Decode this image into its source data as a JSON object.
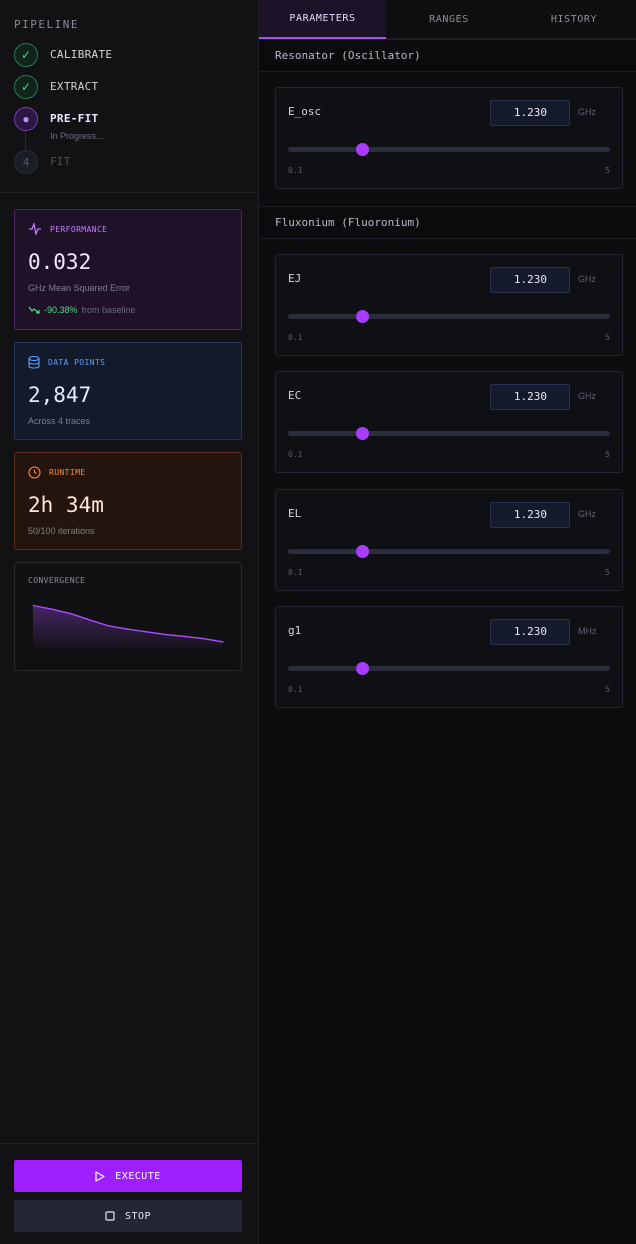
{
  "pipeline": {
    "title": "PIPELINE",
    "steps": [
      {
        "label": "CALIBRATE",
        "status": "done"
      },
      {
        "label": "EXTRACT",
        "status": "done"
      },
      {
        "label": "PRE-FIT",
        "status": "active",
        "sub": "In Progress..."
      },
      {
        "label": "FIT",
        "status": "pending",
        "number": "4"
      }
    ]
  },
  "metrics": {
    "performance": {
      "title": "PERFORMANCE",
      "value": "0.032",
      "desc": "GHz Mean Squared Error",
      "delta": "-90.38%",
      "delta_suffix": "from baseline",
      "color": "#c879ff"
    },
    "data_points": {
      "title": "DATA POINTS",
      "value": "2,847",
      "desc": "Across 4 traces",
      "color": "#5c9eff"
    },
    "runtime": {
      "title": "RUNTIME",
      "value": "2h 34m",
      "desc": "50/100 iterations",
      "color": "#ff8a3d"
    },
    "convergence": {
      "title": "CONVERGENCE"
    }
  },
  "chart_data": {
    "type": "area",
    "title": "CONVERGENCE",
    "x": [
      0,
      1,
      2,
      3,
      4,
      5,
      6,
      7,
      8,
      9,
      10
    ],
    "y": [
      1.0,
      0.92,
      0.82,
      0.68,
      0.55,
      0.48,
      0.42,
      0.36,
      0.32,
      0.27,
      0.2
    ],
    "ylim": [
      0,
      1.1
    ],
    "color": "#a84dff",
    "grid": false
  },
  "actions": {
    "execute": "EXECUTE",
    "stop": "STOP"
  },
  "tabs": [
    "PARAMETERS",
    "RANGES",
    "HISTORY"
  ],
  "active_tab": "PARAMETERS",
  "sections": [
    {
      "title": "Resonator (Oscillator)",
      "params": [
        {
          "name": "E_osc",
          "value": "1.230",
          "unit": "GHz",
          "min": "0.1",
          "max": "5",
          "level": 0.23
        }
      ]
    },
    {
      "title": "Fluxonium (Fluoronium)",
      "params": [
        {
          "name": "EJ",
          "value": "1.230",
          "unit": "GHz",
          "min": "0.1",
          "max": "5",
          "level": 0.23
        },
        {
          "name": "EC",
          "value": "1.230",
          "unit": "GHz",
          "min": "0.1",
          "max": "5",
          "level": 0.23
        },
        {
          "name": "EL",
          "value": "1.230",
          "unit": "GHz",
          "min": "0.1",
          "max": "5",
          "level": 0.23
        },
        {
          "name": "g1",
          "value": "1.230",
          "unit": "MHz",
          "min": "0.1",
          "max": "5",
          "level": 0.23
        }
      ]
    }
  ]
}
